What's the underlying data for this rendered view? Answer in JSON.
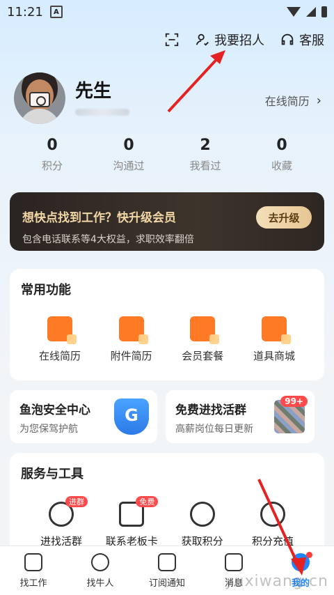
{
  "status_bar": {
    "time": "11:21",
    "badge": "A"
  },
  "top_actions": {
    "scan_icon": "scan-icon",
    "recruit_label": "我要招人",
    "service_label": "客服"
  },
  "profile": {
    "name": "先生",
    "online_resume_label": "在线简历"
  },
  "stats": [
    {
      "value": "0",
      "label": "积分"
    },
    {
      "value": "0",
      "label": "沟通过"
    },
    {
      "value": "2",
      "label": "我看过"
    },
    {
      "value": "0",
      "label": "收藏"
    }
  ],
  "member_banner": {
    "title": "想快点找到工作？快升级会员",
    "subtitle": "包含电话联系等4大权益，求职效率翻倍",
    "button": "去升级"
  },
  "common_functions": {
    "title": "常用功能",
    "items": [
      "在线简历",
      "附件简历",
      "会员套餐",
      "道具商城"
    ]
  },
  "promo_cards": [
    {
      "title": "鱼泡安全中心",
      "subtitle": "为您保驾护航"
    },
    {
      "title": "免费进找活群",
      "subtitle": "高薪岗位每日更新",
      "badge": "99+"
    }
  ],
  "services": {
    "title": "服务与工具",
    "items": [
      {
        "label": "进找活群",
        "tag": "进群"
      },
      {
        "label": "联系老板卡",
        "tag": "免费"
      },
      {
        "label": "获取积分",
        "tag": ""
      },
      {
        "label": "积分充值",
        "tag": ""
      }
    ]
  },
  "bottom_nav": [
    {
      "label": "找工作"
    },
    {
      "label": "找牛人"
    },
    {
      "label": "订阅通知"
    },
    {
      "label": "消息"
    },
    {
      "label": "我的"
    }
  ],
  "watermark": "yuxiwang.cn",
  "colors": {
    "accent": "#1e86ff",
    "orange": "#ff7a25",
    "annotation_red": "#e52222"
  }
}
